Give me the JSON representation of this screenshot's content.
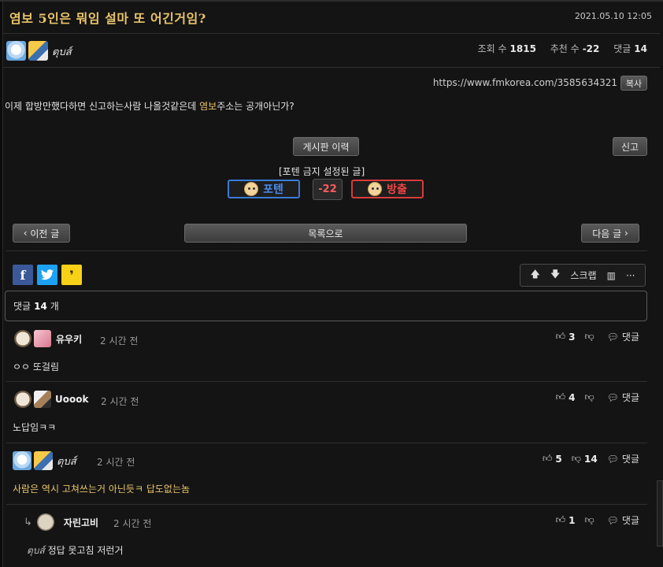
{
  "post": {
    "title": "염보 5인은 뭐임 설마 또 어긴거임?",
    "date": "2021.05.10 12:05",
    "author_nick": "ตุบส์",
    "views_label": "조회 수",
    "views": "1815",
    "recommend_label": "추천 수",
    "recommend": "-22",
    "comments_label": "댓글",
    "comments": "14",
    "url": "https://www.fmkorea.com/3585634321",
    "copy_label": "복사",
    "body_part1": "이제 합방만했다하면 신고하는사람 나올것같은데 ",
    "body_highlight": "염보",
    "body_part2": "주소는 공개아닌가?"
  },
  "actions": {
    "history_label": "게시판 이력",
    "report_label": "신고",
    "no_poten_label": "[포텐 금지 설정된 글]",
    "poten_label": "포텐",
    "score": "-22",
    "out_label": "방출",
    "prev_label": "이전 글",
    "list_label": "목록으로",
    "next_label": "다음 글",
    "scrap_label": "스크랩"
  },
  "comment_header": {
    "label": "댓글",
    "count": "14",
    "unit": "개"
  },
  "comments": [
    {
      "name": "유우키",
      "time": "2 시간 전",
      "text": "ㅇㅇ 또걸림",
      "likes": "3",
      "dislikes": "",
      "reply_label": "댓글"
    },
    {
      "name": "Uoook",
      "time": "2 시간 전",
      "text": "노답임ㅋㅋ",
      "likes": "4",
      "dislikes": "",
      "reply_label": "댓글"
    },
    {
      "name": "ตุบส์",
      "time": "2 시간 전",
      "text": "사람은 역시 고쳐쓰는거 아닌듯ㅋ 답도없는놈",
      "likes": "5",
      "dislikes": "14",
      "reply_label": "댓글"
    },
    {
      "name": "자린고비",
      "time": "2 시간 전",
      "text_prefix": "ตุบส์",
      "text": "정답 못고침 저런거",
      "likes": "1",
      "dislikes": "",
      "reply_label": "댓글"
    }
  ],
  "icons": {
    "accent": "#e9c46a",
    "poten_color": "#3a7bd5",
    "out_color": "#d83b3b"
  }
}
